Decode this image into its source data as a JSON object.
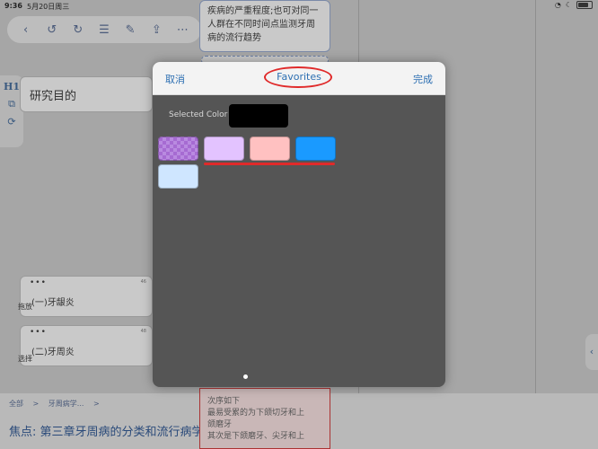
{
  "status": {
    "time": "9:36",
    "date": "5月20日周三"
  },
  "toolbar": {
    "icons": [
      "chevron-left-icon",
      "undo-icon",
      "redo-icon",
      "list-icon",
      "edit-icon",
      "share-icon",
      "more-icon"
    ]
  },
  "left_rail": {
    "h1": "H1"
  },
  "background": {
    "top_node_text": [
      "疾病的严重程度;也可对同一",
      "人群在不同时间点监测牙周",
      "病的流行趋势"
    ],
    "goal_title": "研究目的",
    "card1": {
      "text": "(一)牙龈炎",
      "num": "46"
    },
    "card2": {
      "text": "(二)牙周炎",
      "num": "48"
    },
    "side_label_drag": "拖放",
    "side_label_select": "选择",
    "lower_node_text": [
      "次序如下",
      "最易受累的为下颌切牙和上",
      "颌磨牙",
      "其次是下颌磨牙、尖牙和上"
    ]
  },
  "breadcrumb": {
    "items": [
      "全部",
      ">",
      "牙周病学...",
      ">"
    ]
  },
  "focus_title": "焦点:  第三章牙周病的分类和流行病学",
  "modal": {
    "cancel_label": "取消",
    "title": "Favorites",
    "done_label": "完成",
    "selected_color_label": "Selected Color",
    "selected_color": "#000000",
    "swatches": [
      "#a66bd2",
      "#e3c3ff",
      "#ffc1c1",
      "#1a9aff",
      "#cfe6ff"
    ]
  }
}
